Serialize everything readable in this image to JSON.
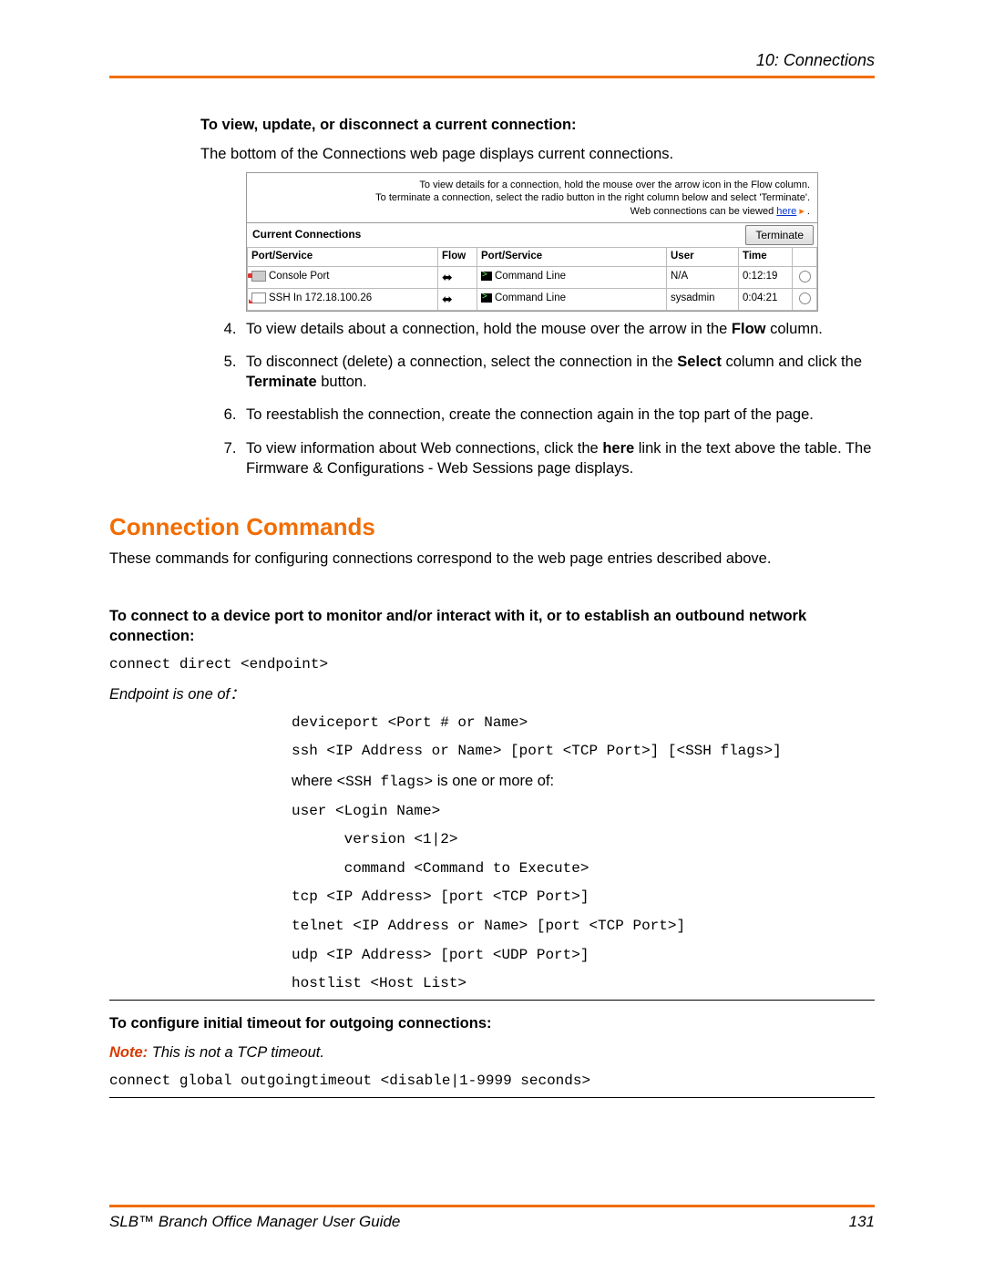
{
  "header": {
    "chapter": "10: Connections"
  },
  "section1": {
    "heading": "To view, update, or disconnect a current connection:",
    "intro": "The bottom of the Connections web page displays current connections."
  },
  "screenshot": {
    "tip1": "To view details for a connection, hold the mouse over the arrow icon in the Flow column.",
    "tip2": "To terminate a connection, select the radio button in the right column below and select 'Terminate'.",
    "tip3a": "Web connections can be viewed ",
    "tip3_link": "here",
    "tip3b": " .",
    "bar_title": "Current Connections",
    "terminate": "Terminate",
    "cols": {
      "c1": "Port/Service",
      "c2": "Flow",
      "c3": "Port/Service",
      "c4": "User",
      "c5": "Time"
    },
    "rows": [
      {
        "ps1": "Console Port",
        "ps2": "Command Line",
        "user": "N/A",
        "time": "0:12:19"
      },
      {
        "ps1": "SSH In 172.18.100.26",
        "ps2": "Command Line",
        "user": "sysadmin",
        "time": "0:04:21"
      }
    ]
  },
  "steps": {
    "s4a": "To view details about a connection, hold the mouse over the arrow in the ",
    "s4b": "Flow",
    "s4c": " column.",
    "s5a": "To disconnect (delete) a connection, select the connection in the ",
    "s5b": "Select",
    "s5c": " column and click the ",
    "s5d": "Terminate",
    "s5e": " button.",
    "s6": "To reestablish the connection, create the connection again in the top part of the page.",
    "s7a": "To view information about Web connections, click the ",
    "s7b": "here",
    "s7c": " link in the text above the table. The Firmware & Configurations  - Web Sessions page displays."
  },
  "commands": {
    "title": "Connection Commands",
    "intro": "These commands for configuring connections correspond to the web page entries described above.",
    "connect_heading": "To connect to a device port to monitor and/or interact with it, or to establish an outbound network connection:",
    "cmd1": "connect direct <endpoint>",
    "endpoint_label": "Endpoint is one of：",
    "ep1": "deviceport <Port # or Name>",
    "ep2": "ssh <IP Address or Name> [port <TCP Port>] [<SSH flags>]",
    "ep3a": "where ",
    "ep3b": "<SSH flags>",
    "ep3c": " is one or more of:",
    "ep4": "user <Login Name>",
    "ep5": "      version <1|2>",
    "ep6": "      command <Command to Execute>",
    "ep7": "tcp <IP Address> [port <TCP Port>]",
    "ep8": "telnet <IP Address or Name> [port <TCP Port>]",
    "ep9": "udp <IP Address> [port <UDP Port>]",
    "ep10": "hostlist <Host List>",
    "timeout_heading": "To configure initial timeout for outgoing connections:",
    "note_label": "Note:",
    "note_text": " This is not a TCP timeout.",
    "cmd2": "connect global outgoingtimeout <disable|1-9999 seconds>"
  },
  "footer": {
    "guide": "SLB™ Branch Office Manager User Guide",
    "page": "131"
  }
}
